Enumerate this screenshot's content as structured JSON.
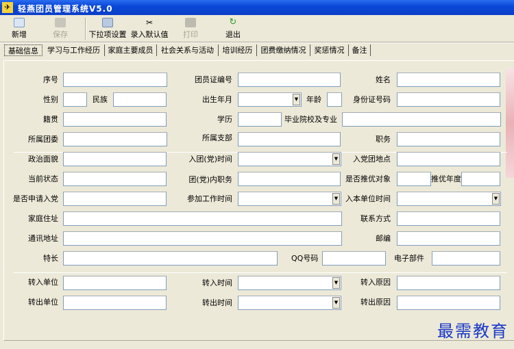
{
  "window": {
    "title": "轻燕团员管理系统V5.0"
  },
  "toolbar": {
    "new": "新增",
    "save": "保存",
    "dropdown_settings": "下拉项设置",
    "default_values": "录入默认值",
    "print": "打印",
    "exit": "退出"
  },
  "tabs": [
    "基础信息",
    "学习与工作经历",
    "家庭主要成员",
    "社会关系与活动",
    "培训经历",
    "团费缴纳情况",
    "奖惩情况",
    "备注"
  ],
  "fields": {
    "serial": "序号",
    "member_card_no": "团员证编号",
    "name": "姓名",
    "gender": "性别",
    "ethnicity": "民族",
    "birth_date": "出生年月",
    "age": "年龄",
    "id_number": "身份证号码",
    "native_place": "籍贯",
    "education": "学历",
    "school_major": "毕业院校及专业",
    "league_committee": "所属团委",
    "branch": "所属支部",
    "position": "职务",
    "political_status": "政治面貌",
    "join_date": "入团(党)时间",
    "join_place": "入党团地点",
    "current_status": "当前状态",
    "inner_post": "团(党)内职务",
    "recommended": "是否推优对象",
    "recommend_year": "推优年度",
    "apply_party": "是否申请入党",
    "work_start": "参加工作时间",
    "unit_join": "入本单位时间",
    "home_address": "家庭住址",
    "contact": "联系方式",
    "mail_address": "通讯地址",
    "postcode": "邮编",
    "specialty": "特长",
    "qq": "QQ号码",
    "email": "电子部件",
    "transfer_in_unit": "转入单位",
    "transfer_in_time": "转入时间",
    "transfer_in_reason": "转入原因",
    "transfer_out_unit": "转出单位",
    "transfer_out_time": "转出时间",
    "transfer_out_reason": "转出原因"
  },
  "watermark": "最需教育"
}
